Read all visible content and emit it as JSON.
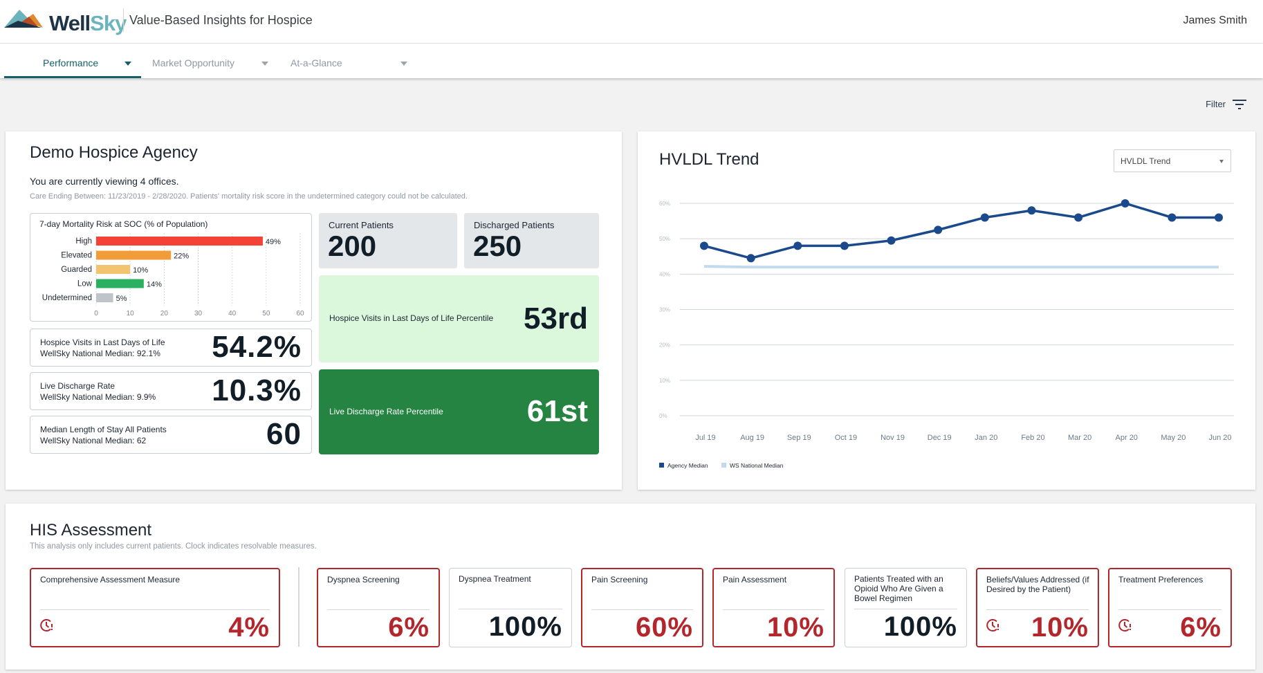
{
  "header": {
    "brand": {
      "part1": "Well",
      "part2": "Sky"
    },
    "app_title": "Value-Based Insights for Hospice",
    "user_name": "James Smith"
  },
  "tabs": [
    {
      "label": "Performance",
      "active": true
    },
    {
      "label": "Market Opportunity",
      "active": false
    },
    {
      "label": "At-a-Glance",
      "active": false
    }
  ],
  "filter": {
    "label": "Filter",
    "icon": "filter-icon"
  },
  "agency": {
    "title": "Demo Hospice Agency",
    "viewing": "You are currently viewing 4 offices.",
    "care_ending": "Care Ending Between: 11/23/2019 - 2/28/2020. Patients' mortality risk score in the undetermined category could not be calculated.",
    "current_patients": {
      "label": "Current Patients",
      "value": "200"
    },
    "discharged_patients": {
      "label": "Discharged Patients",
      "value": "250"
    },
    "metrics": [
      {
        "label": "Hospice Visits in Last Days of Life",
        "median": "WellSky National Median: 92.1%",
        "value": "54.2%"
      },
      {
        "label": "Live Discharge Rate",
        "median": "WellSky National Median: 9.9%",
        "value": "10.3%"
      },
      {
        "label": "Median Length of Stay All Patients",
        "median": "WellSky National Median: 62",
        "value": "60"
      }
    ],
    "percentiles": [
      {
        "label": "Hospice Visits in Last Days of Life Percentile",
        "value": "53rd",
        "color": "#dbf8dd"
      },
      {
        "label": "Live Discharge Rate Percentile",
        "value": "61st",
        "color": "#258442"
      }
    ]
  },
  "trend": {
    "title": "HVLDL Trend",
    "select_value": "HVLDL Trend"
  },
  "his": {
    "title": "HIS Assessment",
    "subtitle": "This analysis only includes current patients. Clock indicates resolvable measures.",
    "tiles": [
      {
        "label": "Comprehensive Assessment Measure",
        "value": "4%",
        "status": "alert",
        "clock": true
      },
      {
        "label": "Dyspnea Screening",
        "value": "6%",
        "status": "alert",
        "clock": false
      },
      {
        "label": "Dyspnea Treatment",
        "value": "100%",
        "status": "ok",
        "clock": false
      },
      {
        "label": "Pain Screening",
        "value": "60%",
        "status": "alert",
        "clock": false
      },
      {
        "label": "Pain Assessment",
        "value": "10%",
        "status": "alert",
        "clock": false
      },
      {
        "label": "Patients Treated with an Opioid Who Are Given a Bowel Regimen",
        "value": "100%",
        "status": "ok",
        "clock": false
      },
      {
        "label": "Beliefs/Values Addressed (if Desired by the Patient)",
        "value": "10%",
        "status": "alert",
        "clock": true
      },
      {
        "label": "Treatment Preferences",
        "value": "6%",
        "status": "alert",
        "clock": true
      }
    ]
  },
  "chart_data": [
    {
      "type": "bar",
      "orientation": "horizontal",
      "title": "7-day Mortality Risk at SOC (% of Population)",
      "categories": [
        "High",
        "Elevated",
        "Guarded",
        "Low",
        "Undetermined"
      ],
      "values": [
        49,
        22,
        10,
        14,
        5
      ],
      "data_labels": [
        "49%",
        "22%",
        "10%",
        "14%",
        "5%"
      ],
      "colors": [
        "#f44336",
        "#f09c38",
        "#f2c46f",
        "#29b061",
        "#bec4ca"
      ],
      "xlim": [
        0,
        60
      ],
      "xticks": [
        0,
        10,
        20,
        30,
        40,
        50,
        60
      ],
      "grid": "vertical-dotted"
    },
    {
      "type": "line",
      "title": "HVLDL Trend",
      "x": [
        "Jul 19",
        "Aug 19",
        "Sep 19",
        "Oct 19",
        "Nov 19",
        "Dec 19",
        "Jan 20",
        "Feb 20",
        "Mar 20",
        "Apr 20",
        "May 20",
        "Jun 20"
      ],
      "series": [
        {
          "name": "Agency Median",
          "color": "#1b4a8c",
          "values": [
            48,
            44.5,
            48,
            48,
            49.5,
            52.5,
            56,
            58,
            56,
            60,
            56,
            56
          ]
        },
        {
          "name": "WS National Median",
          "color": "#c0dbef",
          "values": [
            42.2,
            42,
            42,
            42,
            42,
            42,
            42,
            42,
            42,
            42,
            42,
            42
          ]
        }
      ],
      "ylim": [
        0,
        60
      ],
      "yticks": [
        "0%",
        "10%",
        "20%",
        "30%",
        "40%",
        "50%",
        "60%"
      ],
      "grid": true,
      "legend": "bottom-left"
    }
  ]
}
